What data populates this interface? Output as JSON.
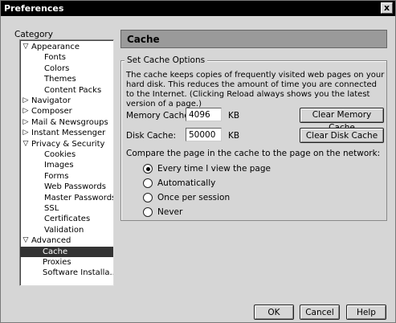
{
  "window": {
    "title": "Preferences",
    "close_glyph": "x"
  },
  "sidebar": {
    "label": "Category",
    "items": [
      {
        "label": "Appearance",
        "twisty": "▽",
        "indent": 0
      },
      {
        "label": "Fonts",
        "twisty": "",
        "indent": 2
      },
      {
        "label": "Colors",
        "twisty": "",
        "indent": 2
      },
      {
        "label": "Themes",
        "twisty": "",
        "indent": 2
      },
      {
        "label": "Content Packs",
        "twisty": "",
        "indent": 2
      },
      {
        "label": "Navigator",
        "twisty": "▷",
        "indent": 0
      },
      {
        "label": "Composer",
        "twisty": "▷",
        "indent": 0
      },
      {
        "label": "Mail & Newsgroups",
        "twisty": "▷",
        "indent": 0
      },
      {
        "label": "Instant Messenger",
        "twisty": "▷",
        "indent": 0
      },
      {
        "label": "Privacy & Security",
        "twisty": "▽",
        "indent": 0
      },
      {
        "label": "Cookies",
        "twisty": "",
        "indent": 2
      },
      {
        "label": "Images",
        "twisty": "",
        "indent": 2
      },
      {
        "label": "Forms",
        "twisty": "",
        "indent": 2
      },
      {
        "label": "Web Passwords",
        "twisty": "",
        "indent": 2
      },
      {
        "label": "Master Passwords",
        "twisty": "",
        "indent": 2
      },
      {
        "label": "SSL",
        "twisty": "",
        "indent": 2
      },
      {
        "label": "Certificates",
        "twisty": "",
        "indent": 2
      },
      {
        "label": "Validation",
        "twisty": "",
        "indent": 2
      },
      {
        "label": "Advanced",
        "twisty": "▽",
        "indent": 0
      },
      {
        "label": "Cache",
        "twisty": "",
        "indent": 1,
        "selected": true
      },
      {
        "label": "Proxies",
        "twisty": "",
        "indent": 1
      },
      {
        "label": "Software Installa...",
        "twisty": "",
        "indent": 1
      }
    ]
  },
  "pane": {
    "title": "Cache",
    "group_label": "Set Cache Options",
    "description": "The cache keeps copies of frequently visited web pages on your hard disk. This reduces the amount of time you are connected to the Internet. (Clicking Reload always shows you the latest version of a page.)",
    "memory_label": "Memory Cache:",
    "memory_value": "4096",
    "memory_unit": "KB",
    "clear_memory": "Clear Memory Cache",
    "disk_label": "Disk Cache:",
    "disk_value": "50000",
    "disk_unit": "KB",
    "clear_disk": "Clear Disk Cache",
    "compare_label": "Compare the page in the cache to the page on the network:",
    "options": [
      {
        "label": "Every time I view the page",
        "checked": true
      },
      {
        "label": "Automatically",
        "checked": false
      },
      {
        "label": "Once per session",
        "checked": false
      },
      {
        "label": "Never",
        "checked": false
      }
    ]
  },
  "footer": {
    "ok": "OK",
    "cancel": "Cancel",
    "help": "Help"
  }
}
